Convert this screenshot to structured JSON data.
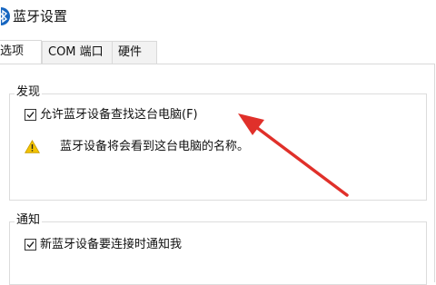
{
  "window": {
    "title": "蓝牙设置"
  },
  "tabs": [
    {
      "label": "选项",
      "active": true
    },
    {
      "label": "COM 端口",
      "active": false
    },
    {
      "label": "硬件",
      "active": false
    }
  ],
  "discovery": {
    "group_label": "发现",
    "allow_discovery_label": "允许蓝牙设备查找这台电脑(F)",
    "allow_discovery_checked": true,
    "warning_text": "蓝牙设备将会看到这台电脑的名称。"
  },
  "notifications": {
    "group_label": "通知",
    "notify_new_device_label": "新蓝牙设备要连接时通知我",
    "notify_new_device_checked": true
  },
  "colors": {
    "annotation_arrow": "#e0302a",
    "warning_icon": "#f2c200",
    "bluetooth_icon": "#1565c0"
  }
}
